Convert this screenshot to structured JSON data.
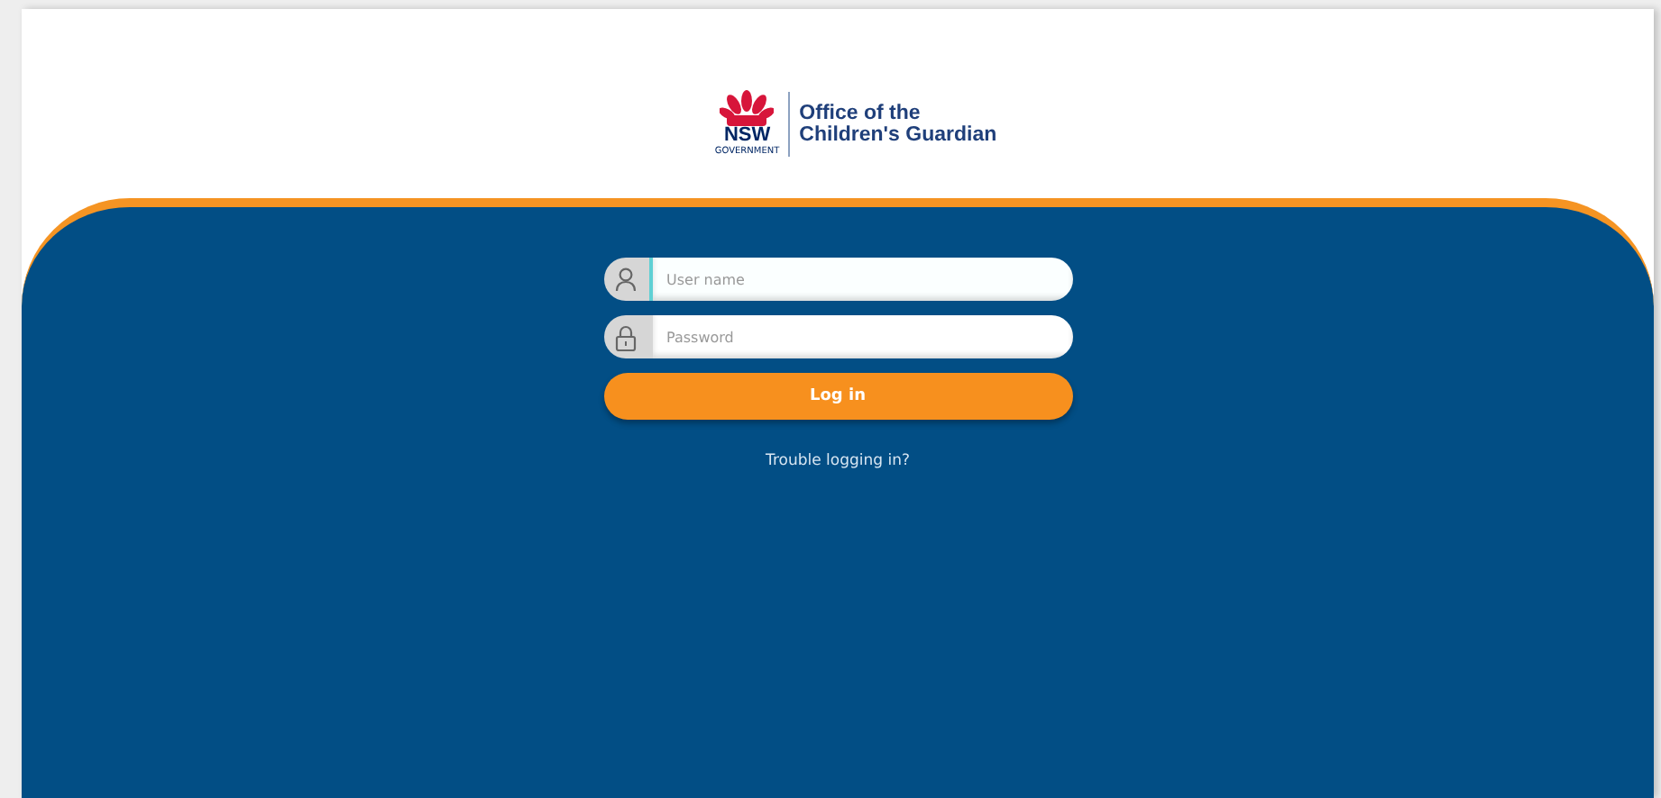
{
  "logo": {
    "mark": "NSW",
    "mark_sub": "GOVERNMENT",
    "title_lines": [
      "Office of the",
      "Children's Guardian"
    ]
  },
  "fields": [
    {
      "kind": "user",
      "placeholder": "User name",
      "focused": true
    },
    {
      "kind": "password",
      "placeholder": "Password",
      "focused": false
    }
  ],
  "login_button": "Log in",
  "help_link": "Trouble logging in?"
}
